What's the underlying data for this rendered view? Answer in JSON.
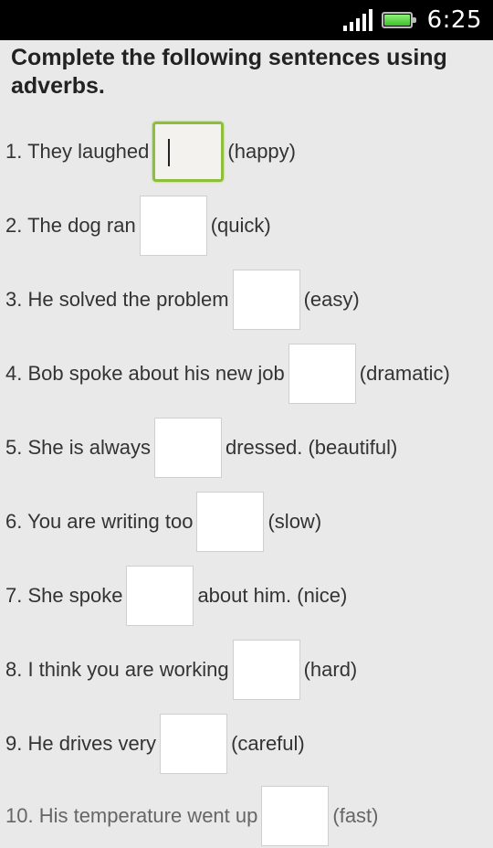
{
  "status_bar": {
    "time": "6:25",
    "signal_icon": "signal-bars-icon",
    "battery_icon": "battery-full-icon"
  },
  "instructions": "Complete the following sentences using adverbs.",
  "questions": [
    {
      "text": "1. They laughed",
      "hint": "(happy)",
      "focused": true
    },
    {
      "text": "2. The dog ran",
      "hint": "(quick)"
    },
    {
      "text": "3. He solved the problem",
      "hint": "(easy)"
    },
    {
      "text": "4. Bob spoke about his new job",
      "hint": "(dramatic)"
    },
    {
      "text": "5. She is always",
      "hint": "dressed. (beautiful)"
    },
    {
      "text": "6. You are writing too",
      "hint": "(slow)"
    },
    {
      "text": "7. She spoke",
      "hint": "about him. (nice)"
    },
    {
      "text": "8. I think you are working",
      "hint": "(hard)"
    },
    {
      "text": "9. He drives very",
      "hint": "(careful)"
    },
    {
      "text": "10. His temperature went up",
      "hint": "(fast)"
    }
  ],
  "colors": {
    "background": "#e9e9e9",
    "focus_border": "#8fbd3e"
  }
}
